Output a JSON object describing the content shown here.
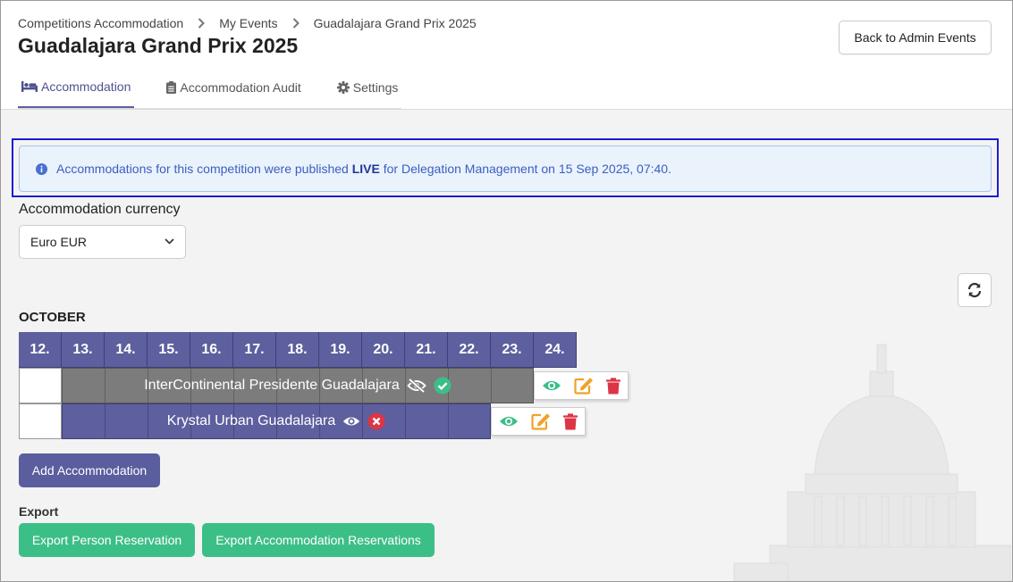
{
  "breadcrumb": [
    "Competitions Accommodation",
    "My Events",
    "Guadalajara Grand Prix 2025"
  ],
  "page_title": "Guadalajara Grand Prix 2025",
  "back_button": "Back to Admin Events",
  "tabs": [
    {
      "label": "Accommodation",
      "icon": "bed-icon",
      "active": true
    },
    {
      "label": "Accommodation Audit",
      "icon": "clipboard-icon",
      "active": false
    },
    {
      "label": "Settings",
      "icon": "gear-icon",
      "active": false
    }
  ],
  "alert": {
    "prefix": "Accommodations for this competition were published ",
    "highlight": "LIVE",
    "suffix": " for Delegation Management on 15 Sep 2025, 07:40.",
    "icon": "info-circle-icon"
  },
  "currency": {
    "label": "Accommodation currency",
    "selected": "Euro EUR"
  },
  "calendar": {
    "month": "OCTOBER",
    "days": [
      "12.",
      "13.",
      "14.",
      "15.",
      "16.",
      "17.",
      "18.",
      "19.",
      "20.",
      "21.",
      "22.",
      "23.",
      "24."
    ]
  },
  "accommodations": [
    {
      "name": "InterContinental Presidente Guadalajara",
      "visibility_icon": "eye-slash-icon",
      "status_icon": "check-circle-icon",
      "color": "#7c7c7c"
    },
    {
      "name": "Krystal Urban Guadalajara",
      "visibility_icon": "eye-icon",
      "status_icon": "x-circle-icon",
      "color": "#5d5f9e"
    }
  ],
  "add_button": "Add Accommodation",
  "export": {
    "label": "Export",
    "person_button": "Export Person Reservation",
    "accommodation_button": "Export Accommodation Reservations"
  },
  "colors": {
    "primary": "#5d5f9e",
    "success": "#3cbf87",
    "warning": "#f0a22a",
    "danger": "#dc3545",
    "info_text": "#3a5fc0"
  }
}
